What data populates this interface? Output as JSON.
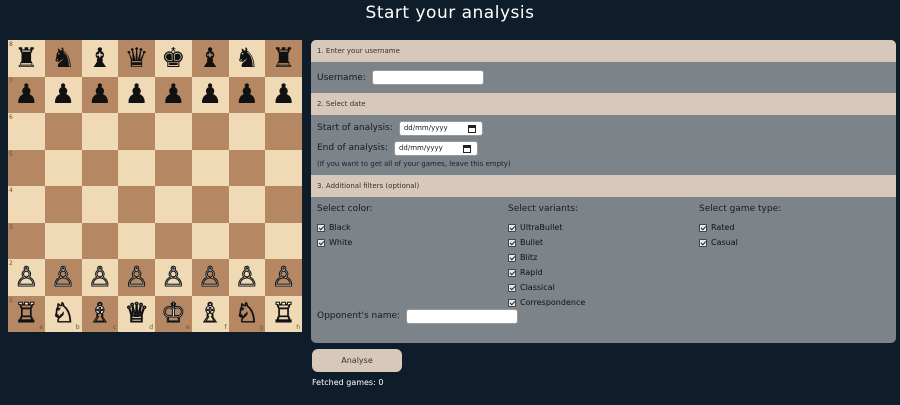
{
  "page_title": "Start your analysis",
  "board": {
    "ranks": [
      "8",
      "7",
      "6",
      "5",
      "4",
      "3",
      "2",
      "1"
    ],
    "files": [
      "a",
      "b",
      "c",
      "d",
      "e",
      "f",
      "g",
      "h"
    ],
    "rows": [
      [
        "♜",
        "♞",
        "♝",
        "♛",
        "♚",
        "♝",
        "♞",
        "♜"
      ],
      [
        "♟",
        "♟",
        "♟",
        "♟",
        "♟",
        "♟",
        "♟",
        "♟"
      ],
      [
        "",
        "",
        "",
        "",
        "",
        "",
        "",
        ""
      ],
      [
        "",
        "",
        "",
        "",
        "",
        "",
        "",
        ""
      ],
      [
        "",
        "",
        "",
        "",
        "",
        "",
        "",
        ""
      ],
      [
        "",
        "",
        "",
        "",
        "",
        "",
        "",
        ""
      ],
      [
        "♙",
        "♙",
        "♙",
        "♙",
        "♙",
        "♙",
        "♙",
        "♙"
      ],
      [
        "♖",
        "♘",
        "♗",
        "♕",
        "♔",
        "♗",
        "♘",
        "♖"
      ]
    ],
    "colors": {
      "light": "#efdab5",
      "dark": "#b58863"
    }
  },
  "form": {
    "section1": {
      "header": "1. Enter your username",
      "username_label": "Username:",
      "username_value": ""
    },
    "section2": {
      "header": "2. Select date",
      "start_label": "Start of analysis:",
      "start_value": "dd/mm/yyyy",
      "end_label": "End of analysis:",
      "end_value": "dd/mm/yyyy",
      "hint": "(If you want to get all of your games, leave this empty)"
    },
    "section3": {
      "header": "3. Additional filters (optional)",
      "color_title": "Select color:",
      "colors": [
        "Black",
        "White"
      ],
      "variants_title": "Select variants:",
      "variants": [
        "UltraBullet",
        "Bullet",
        "Blitz",
        "Rapid",
        "Classical",
        "Correspondence"
      ],
      "game_type_title": "Select game type:",
      "game_types": [
        "Rated",
        "Casual"
      ],
      "opponent_label": "Opponent's name:",
      "opponent_value": ""
    }
  },
  "analyse_button": "Analyse",
  "fetched_games": "Fetched games: 0"
}
